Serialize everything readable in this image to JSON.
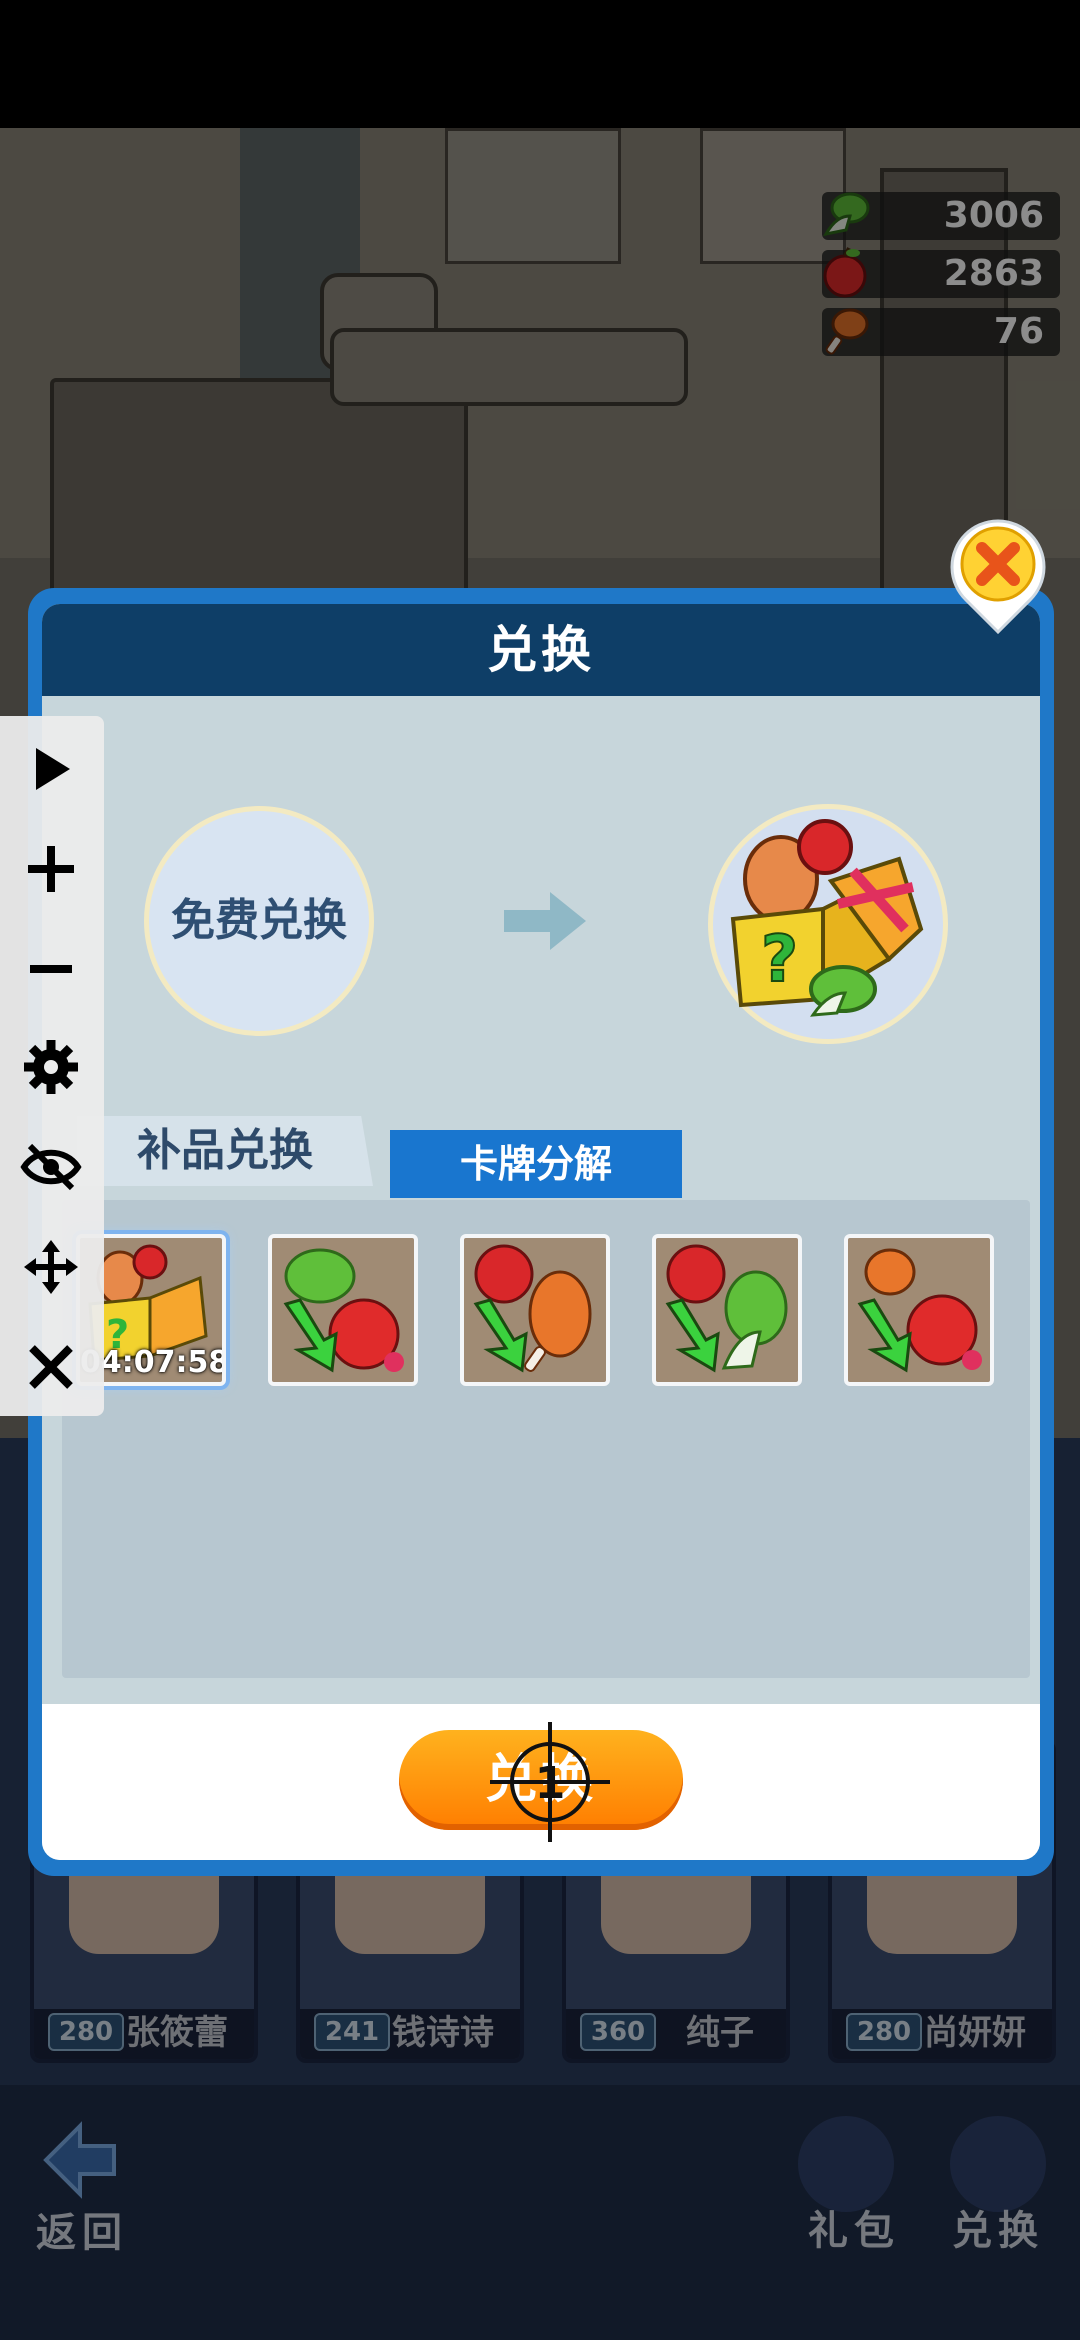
{
  "currencies": [
    {
      "icon": "vegetable-icon",
      "value": "3006"
    },
    {
      "icon": "apple-icon",
      "value": "2863"
    },
    {
      "icon": "drumstick-icon",
      "value": "76"
    }
  ],
  "dialog": {
    "title": "兑换",
    "free_exchange_label": "免费兑换",
    "tabs": [
      {
        "label": "补品兑换",
        "active": true
      },
      {
        "label": "卡牌分解",
        "active": false
      }
    ],
    "items": [
      {
        "icon": "mystery-food-box-icon",
        "timer": "04:07:58",
        "selected": true
      },
      {
        "icon": "vegetable-to-apple-icon",
        "timer": ""
      },
      {
        "icon": "apple-to-drumstick-icon",
        "timer": ""
      },
      {
        "icon": "apple-to-vegetable-icon",
        "timer": ""
      },
      {
        "icon": "drumstick-to-apple-icon",
        "timer": ""
      }
    ],
    "exchange_button": "兑换",
    "crosshair_number": "1"
  },
  "background_cards": [
    {
      "level": "280",
      "name": "张筱蕾"
    },
    {
      "level": "241",
      "name": "钱诗诗"
    },
    {
      "level": "360",
      "name": "纯子"
    },
    {
      "level": "280",
      "name": "尚妍妍"
    }
  ],
  "bottom_nav": {
    "back": "返回",
    "gift": "礼包",
    "exchange": "兑换"
  },
  "toolbar": [
    "play-icon",
    "plus-icon",
    "minus-icon",
    "gear-icon",
    "eye-off-icon",
    "move-icon",
    "close-icon"
  ],
  "colors": {
    "dialog_border": "#1f78c8",
    "header": "#0e3e67",
    "tab_inactive": "#1976cf",
    "button": "#ff8f0a"
  }
}
